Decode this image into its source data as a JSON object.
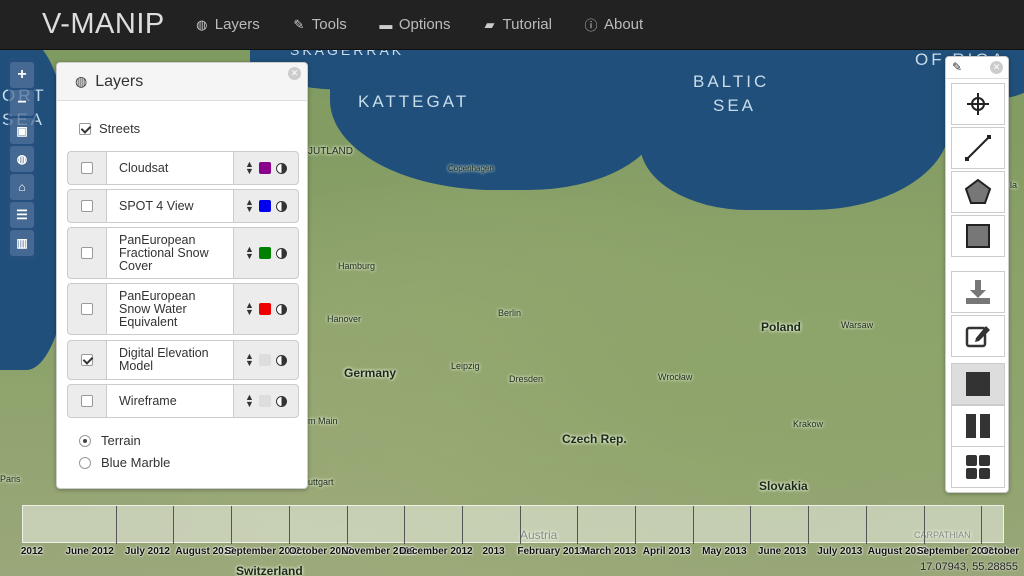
{
  "navbar": {
    "brand": "V-MANIP",
    "items": [
      {
        "label": "Layers",
        "icon": "globe-icon"
      },
      {
        "label": "Tools",
        "icon": "wrench-icon"
      },
      {
        "label": "Options",
        "icon": "cogs-icon"
      },
      {
        "label": "Tutorial",
        "icon": "book-icon"
      },
      {
        "label": "About",
        "icon": "info-icon"
      }
    ]
  },
  "left_toolbar": [
    "zoom-in-icon",
    "zoom-out-icon",
    "image-icon",
    "globe-icon",
    "inbox-icon",
    "list-icon",
    "chart-icon"
  ],
  "layers_panel": {
    "title": "Layers",
    "streets": {
      "label": "Streets",
      "checked": true
    },
    "layers": [
      {
        "name": "Cloudsat",
        "checked": false,
        "color": "#8b008b"
      },
      {
        "name": "SPOT 4 View",
        "checked": false,
        "color": "#0000ee"
      },
      {
        "name": "PanEuropean Fractional Snow Cover",
        "checked": false,
        "color": "#008000"
      },
      {
        "name": "PanEuropean Snow Water Equivalent",
        "checked": false,
        "color": "#ee0000"
      },
      {
        "name": "Digital Elevation Model",
        "checked": true,
        "color": "#dddddd"
      },
      {
        "name": "Wireframe",
        "checked": false,
        "color": "#dddddd"
      }
    ],
    "base_layers": [
      {
        "label": "Terrain",
        "selected": true
      },
      {
        "label": "Blue Marble",
        "selected": false
      }
    ]
  },
  "tools_panel": {
    "tools": [
      "crosshair-icon",
      "line-icon",
      "polygon-icon",
      "rectangle-icon",
      "download-icon",
      "edit-icon",
      "single-view-icon",
      "split-view-icon",
      "quad-view-icon"
    ],
    "active": "single-view-icon"
  },
  "map_labels": {
    "kattegat": "KATTEGAT",
    "baltic1": "BALTIC",
    "baltic2": "SEA",
    "skagerrak": "SKAGERRAK",
    "of_riga": "OF RIGA",
    "north_sea1": "ORT",
    "north_sea2": "SEA",
    "jutland": "JUTLAND",
    "copenhagen": "Copenhagen",
    "hamburg": "Hamburg",
    "hanover": "Hanover",
    "berlin": "Berlin",
    "poland": "Poland",
    "warsaw": "Warsaw",
    "germany": "Germany",
    "leipzig": "Leipzig",
    "dresden": "Dresden",
    "wroclaw": "Wrocław",
    "krakow": "Krakow",
    "czech": "Czech Rep.",
    "slovakia": "Slovakia",
    "switzerland": "Switzerland",
    "austria": "Austria",
    "paris": "Paris",
    "main": "m Main",
    "stuttgart": "uttgart",
    "carpathian": "CARPATHIAN",
    "la": "la"
  },
  "timeline": {
    "labels": [
      "2012",
      "June 2012",
      "July 2012",
      "August 2012",
      "September 2012",
      "October 2012",
      "November 2012",
      "December 2012",
      "2013",
      "February 2013",
      "March 2013",
      "April 2013",
      "May 2013",
      "June 2013",
      "July 2013",
      "August 2013",
      "September 2013",
      "October"
    ]
  },
  "coordinates": "17.07943, 55.28855"
}
